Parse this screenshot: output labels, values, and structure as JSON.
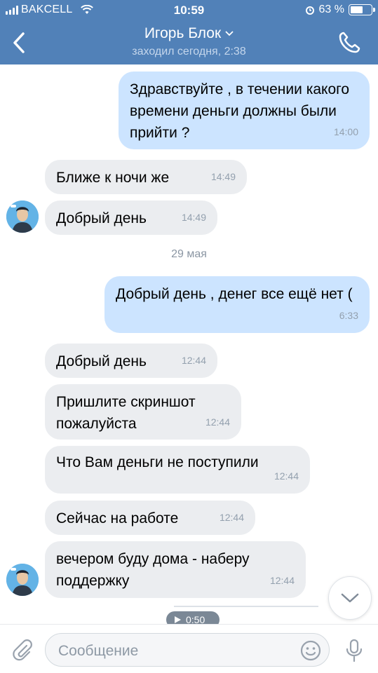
{
  "status_bar": {
    "carrier": "BAKCELL",
    "time": "10:59",
    "battery": "63 %",
    "battery_level": 0.63
  },
  "header": {
    "title": "Игорь Блок",
    "subtitle": "заходил сегодня, 2:38"
  },
  "messages": [
    {
      "dir": "out",
      "text": "Здравствуйте , в течении какого времени деньги должны были прийти ?",
      "time": "14:00"
    },
    {
      "dir": "in",
      "text": "Ближе к ночи же",
      "time": "14:49"
    },
    {
      "dir": "in",
      "text": "Добрый день",
      "time": "14:49"
    },
    {
      "dir": "out",
      "text": "Добрый день , денег все ещё нет (",
      "time": "6:33"
    },
    {
      "dir": "in",
      "text": "Добрый день",
      "time": "12:44"
    },
    {
      "dir": "in",
      "text": "Пришлите скриншот пожалуйста",
      "time": "12:44"
    },
    {
      "dir": "in",
      "text": "Что Вам деньги не поступили",
      "time": "12:44"
    },
    {
      "dir": "in",
      "text": "Сейчас на работе",
      "time": "12:44"
    },
    {
      "dir": "in",
      "text": "вечером буду дома - наберу поддержку",
      "time": "12:44"
    }
  ],
  "date_divider": "29 мая",
  "audio": {
    "duration": "0:50"
  },
  "composer": {
    "placeholder": "Сообщение"
  },
  "colors": {
    "header": "#5181b8",
    "incoming": "#ebedf0",
    "outgoing": "#cce4ff"
  },
  "icons": [
    "back-chevron-icon",
    "phone-icon",
    "paperclip-icon",
    "smile-icon",
    "microphone-icon",
    "chevron-down-icon",
    "play-icon"
  ]
}
